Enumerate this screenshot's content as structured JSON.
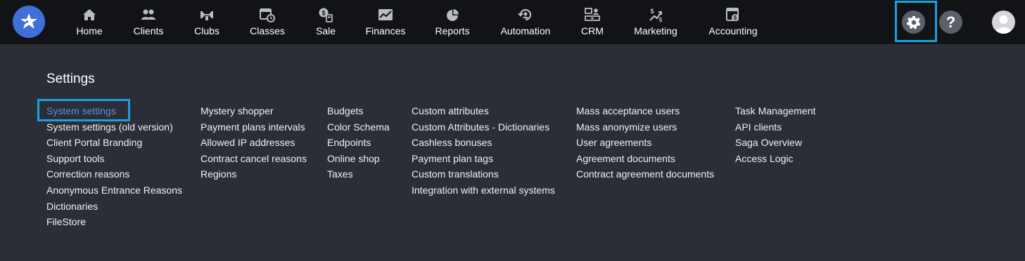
{
  "nav": [
    {
      "label": "Home",
      "icon": "home-icon"
    },
    {
      "label": "Clients",
      "icon": "clients-icon"
    },
    {
      "label": "Clubs",
      "icon": "clubs-icon"
    },
    {
      "label": "Classes",
      "icon": "calendar-clock-icon"
    },
    {
      "label": "Sale",
      "icon": "sale-icon"
    },
    {
      "label": "Finances",
      "icon": "finances-chart-icon"
    },
    {
      "label": "Reports",
      "icon": "pie-chart-icon"
    },
    {
      "label": "Automation",
      "icon": "automation-icon"
    },
    {
      "label": "CRM",
      "icon": "crm-icon"
    },
    {
      "label": "Marketing",
      "icon": "marketing-icon"
    },
    {
      "label": "Accounting",
      "icon": "accounting-icon"
    }
  ],
  "header": {
    "help_label": "?",
    "settings_icon": "gear-icon",
    "avatar_icon": "user-avatar-icon"
  },
  "colors": {
    "topbar": "#121316",
    "panel": "#2b2e36",
    "highlight": "#1ba0e0",
    "active_link": "#5b8ee8",
    "logo": "#3f6fd9"
  },
  "settings": {
    "title": "Settings",
    "columns": [
      [
        "System settings",
        "System settings (old version)",
        "Client Portal Branding",
        "Support tools",
        "Correction reasons",
        "Anonymous Entrance Reasons",
        "Dictionaries",
        "FileStore"
      ],
      [
        "Mystery shopper",
        "Payment plans intervals",
        "Allowed IP addresses",
        "Contract cancel reasons",
        "Regions"
      ],
      [
        "Budgets",
        "Color Schema",
        "Endpoints",
        "Online shop",
        "Taxes"
      ],
      [
        "Custom attributes",
        "Custom Attributes - Dictionaries",
        "Cashless bonuses",
        "Payment plan tags",
        "Custom translations",
        "Integration with external systems"
      ],
      [
        "Mass acceptance users",
        "Mass anonymize users",
        "User agreements",
        "Agreement documents",
        "Contract agreement documents"
      ],
      [
        "Task Management",
        "API clients",
        "Saga Overview",
        "Access Logic"
      ]
    ]
  }
}
